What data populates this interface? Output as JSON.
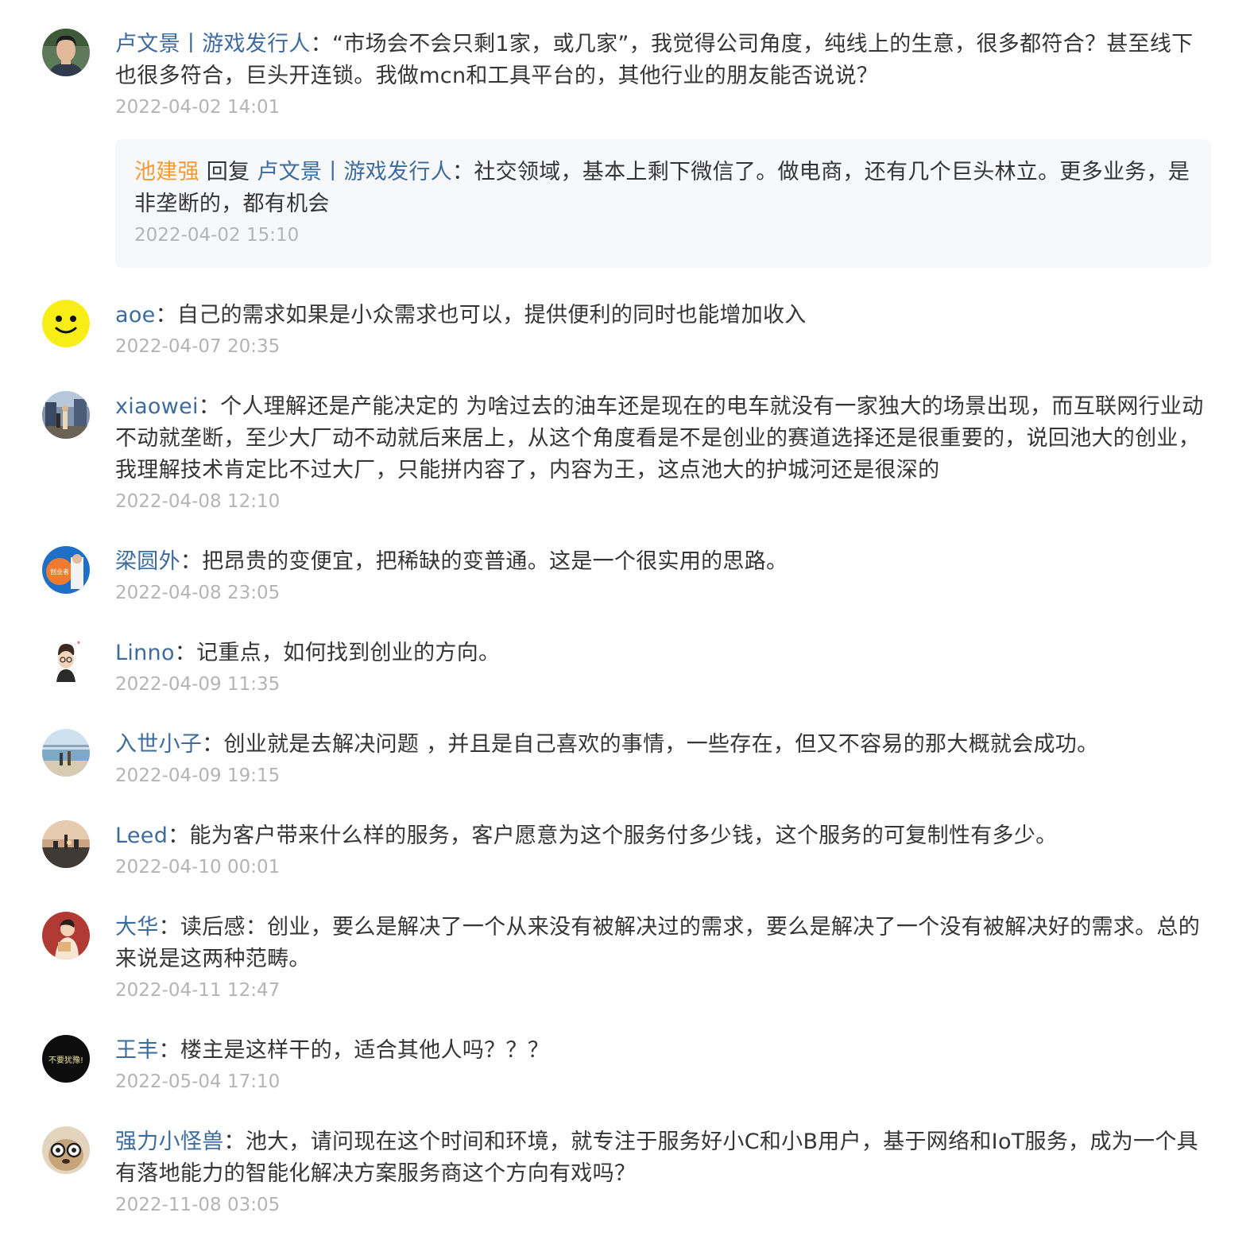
{
  "comments": [
    {
      "author": "卢文景丨游戏发行人",
      "content": "“市场会不会只剩1家，或几家”，我觉得公司角度，纯线上的生意，很多都符合？甚至线下也很多符合，巨头开连锁。我做mcn和工具平台的，其他行业的朋友能否说说？",
      "time": "2022-04-02 14:01",
      "avatar": "photo-man-icon",
      "reply": {
        "author": "池建强",
        "verb": "回复",
        "target": "卢文景丨游戏发行人",
        "content": "社交领域，基本上剩下微信了。做电商，还有几个巨头林立。更多业务，是非垄断的，都有机会",
        "time": "2022-04-02 15:10"
      }
    },
    {
      "author": "aoe",
      "content": "自己的需求如果是小众需求也可以，提供便利的同时也能增加收入",
      "time": "2022-04-07 20:35",
      "avatar": "smiley-face-icon"
    },
    {
      "author": "xiaowei",
      "content": "个人理解还是产能决定的 为啥过去的油车还是现在的电车就没有一家独大的场景出现，而互联网行业动不动就垄断，至少大厂动不动就后来居上，从这个角度看是不是创业的赛道选择还是很重要的，说回池大的创业，我理解技术肯定比不过大厂，只能拼内容了，内容为王，这点池大的护城河还是很深的",
      "time": "2022-04-08 12:10",
      "avatar": "street-photo-icon"
    },
    {
      "author": "梁圆外",
      "content": "把昂贵的变便宜，把稀缺的变普通。这是一个很实用的思路。",
      "time": "2022-04-08 23:05",
      "avatar": "orange-badge-icon"
    },
    {
      "author": "Linno",
      "content": "记重点，如何找到创业的方向。",
      "time": "2022-04-09 11:35",
      "avatar": "cartoon-boy-icon"
    },
    {
      "author": "入世小子",
      "content": "创业就是去解决问题 ，并且是自己喜欢的事情，一些存在，但又不容易的那大概就会成功。",
      "time": "2022-04-09 19:15",
      "avatar": "beach-photo-icon"
    },
    {
      "author": "Leed",
      "content": "能为客户带来什么样的服务，客户愿意为这个服务付多少钱，这个服务的可复制性有多少。",
      "time": "2022-04-10 00:01",
      "avatar": "sunset-photo-icon"
    },
    {
      "author": "大华",
      "content": "读后感：创业，要么是解决了一个从来没有被解决过的需求，要么是解决了一个没有被解决好的需求。总的来说是这两种范畴。",
      "time": "2022-04-11 12:47",
      "avatar": "illustration-person-icon"
    },
    {
      "author": "王丰",
      "content": "楼主是这样干的，适合其他人吗？？？",
      "time": "2022-05-04 17:10",
      "avatar": "black-text-icon",
      "avatar_text": "不要犹豫!"
    },
    {
      "author": "强力小怪兽",
      "content": "池大，请问现在这个时间和环境，就专注于服务好小C和小B用户，基于网络和IoT服务，成为一个具有落地能力的智能化解决方案服务商这个方向有戏吗？",
      "time": "2022-11-08 03:05",
      "avatar": "glasses-dog-icon"
    }
  ],
  "colors": {
    "author": "#3d6b9e",
    "reply_author": "#f59a38",
    "text": "#353535",
    "time": "#b4b4b4",
    "reply_bg": "#f7f8fa"
  }
}
